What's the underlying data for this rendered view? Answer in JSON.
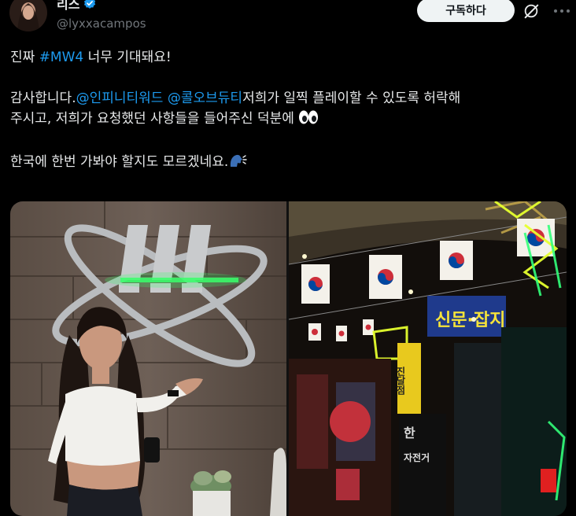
{
  "author": {
    "display_name": "리스",
    "handle": "@lyxxacampos",
    "avatar_icon": "avatar-photo",
    "verified_icon": "verified-badge-icon",
    "verified_color": "#1d9bf0"
  },
  "actions": {
    "subscribe_label": "구독하다",
    "grok_icon": "grok-icon",
    "more_icon": "more-options-icon"
  },
  "tweet": {
    "line1_prefix": "진짜 ",
    "line1_hashtag": "#MW4",
    "line1_suffix": " 너무 기대돼요!",
    "line2_prefix": "감사합니다.",
    "line2_mention1": "@인피니티워드",
    "line2_space": " ",
    "line2_mention2": "@콜오브듀티",
    "line2_suffix": "저희가 일찍 플레이할 수 있도록 허락해",
    "line3": "주시고, 저희가 요청했던 사항들을 들어주신 덕분에 ",
    "line3_emoji": "eyes-emoji",
    "line4": "한국에 한번 가봐야 할지도 모르겠네요.",
    "line4_emoji": "speaking-head-emoji"
  },
  "media": {
    "left_photo": "woman posing in front of Infinity Ward logo",
    "right_photo": "street with Korean flags and neon signs",
    "sign_text_1": "신문·잡지",
    "sign_text_2": "진달점",
    "sign_text_3": "한",
    "sign_text_4": "자전거"
  },
  "colors": {
    "background": "#000000",
    "text": "#e7e9ea",
    "secondary": "#71767b",
    "accent": "#1d9bf0",
    "button_bg": "#eff3f4"
  }
}
